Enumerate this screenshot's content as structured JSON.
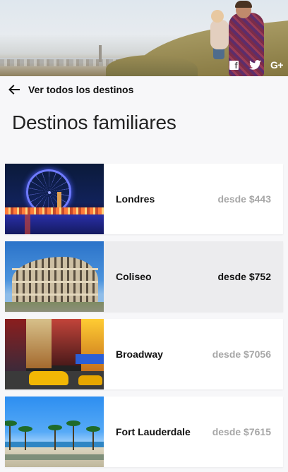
{
  "header": {
    "hero_image": "family-beach-photo",
    "social": [
      {
        "name": "facebook-icon",
        "glyph": "f"
      },
      {
        "name": "twitter-icon",
        "glyph": ""
      },
      {
        "name": "google-plus-icon",
        "glyph": "G+"
      }
    ]
  },
  "nav": {
    "back_label": "Ver todos los destinos",
    "back_icon": "arrow-left-icon"
  },
  "page": {
    "title": "Destinos familiares"
  },
  "destinations": [
    {
      "name": "Londres",
      "price": "desde $443",
      "thumb": "london-eye-night",
      "active": false
    },
    {
      "name": "Coliseo",
      "price": "desde $752",
      "thumb": "colosseum",
      "active": true
    },
    {
      "name": "Broadway",
      "price": "desde $7056",
      "thumb": "broadway-taxis",
      "active": false
    },
    {
      "name": "Fort Lauderdale",
      "price": "desde $7615",
      "thumb": "beach-palms",
      "active": false
    }
  ],
  "colors": {
    "background": "#f7f7f9",
    "card": "#ffffff",
    "card_active": "#ececee",
    "price_muted": "#a7a7a7",
    "text": "#111111"
  }
}
